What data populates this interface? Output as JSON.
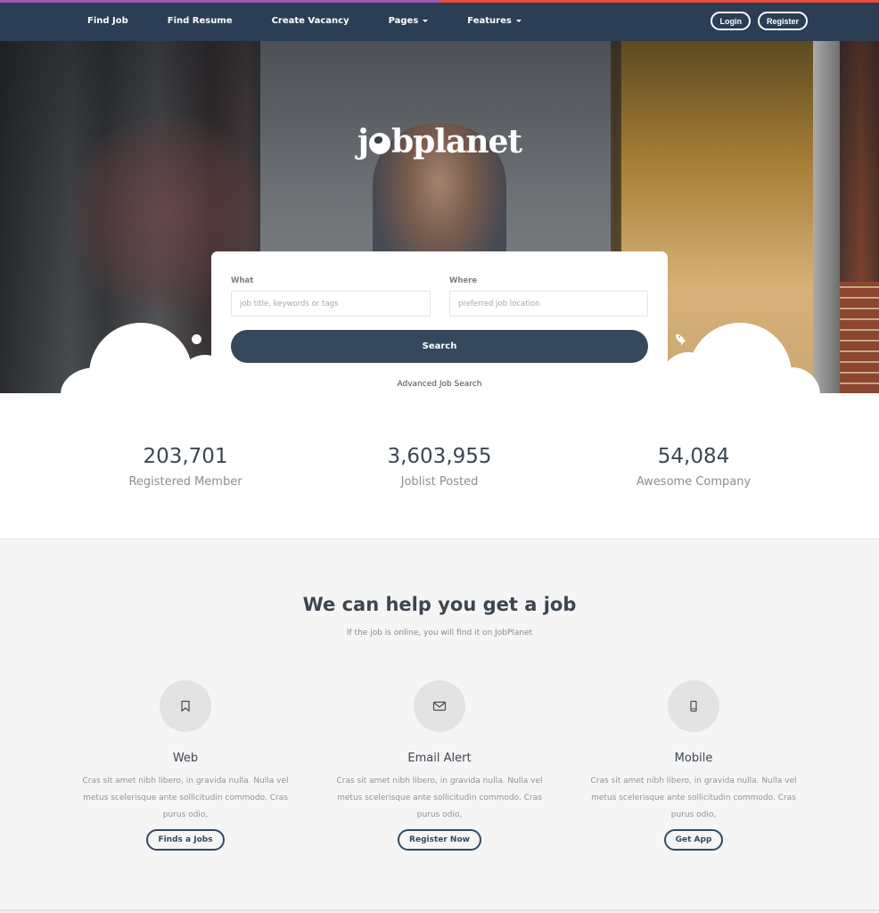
{
  "brand": {
    "logo_prefix": "j",
    "logo_suffix": "bplanet",
    "accent_left": "#9b59b6",
    "accent_right": "#e74c3c",
    "navbar_bg": "#2c3e55",
    "primary": "#34495e"
  },
  "nav": {
    "links": [
      {
        "label": "Find Job",
        "dropdown": false
      },
      {
        "label": "Find Resume",
        "dropdown": false
      },
      {
        "label": "Create Vacancy",
        "dropdown": false
      },
      {
        "label": "Pages",
        "dropdown": true
      },
      {
        "label": "Features",
        "dropdown": true
      }
    ],
    "login_label": "Login",
    "register_label": "Register"
  },
  "search": {
    "what_label": "What",
    "what_placeholder": "job title, keywords or tags",
    "what_value": "",
    "where_label": "Where",
    "where_placeholder": "preferred job location",
    "where_value": "",
    "search_button": "Search",
    "advanced_link": "Advanced Job Search"
  },
  "stats": [
    {
      "value": "203,701",
      "label": "Registered Member"
    },
    {
      "value": "3,603,955",
      "label": "Joblist Posted"
    },
    {
      "value": "54,084",
      "label": "Awesome Company"
    }
  ],
  "help": {
    "title": "We can help you get a job",
    "subtitle": "If the job is online, you will find it on JobPlanet",
    "features": [
      {
        "icon": "bookmark-icon",
        "title": "Web",
        "description": "Cras sit amet nibh libero, in gravida nulla. Nulla vel metus scelerisque ante sollicitudin commodo. Cras purus odio,",
        "button": "Finds a Jobs"
      },
      {
        "icon": "envelope-icon",
        "title": "Email Alert",
        "description": "Cras sit amet nibh libero, in gravida nulla. Nulla vel metus scelerisque ante sollicitudin commodo. Cras purus odio,",
        "button": "Register Now"
      },
      {
        "icon": "mobile-icon",
        "title": "Mobile",
        "description": "Cras sit amet nibh libero, in gravida nulla. Nulla vel metus scelerisque ante sollicitudin commodo. Cras purus odio,",
        "button": "Get App"
      }
    ]
  }
}
